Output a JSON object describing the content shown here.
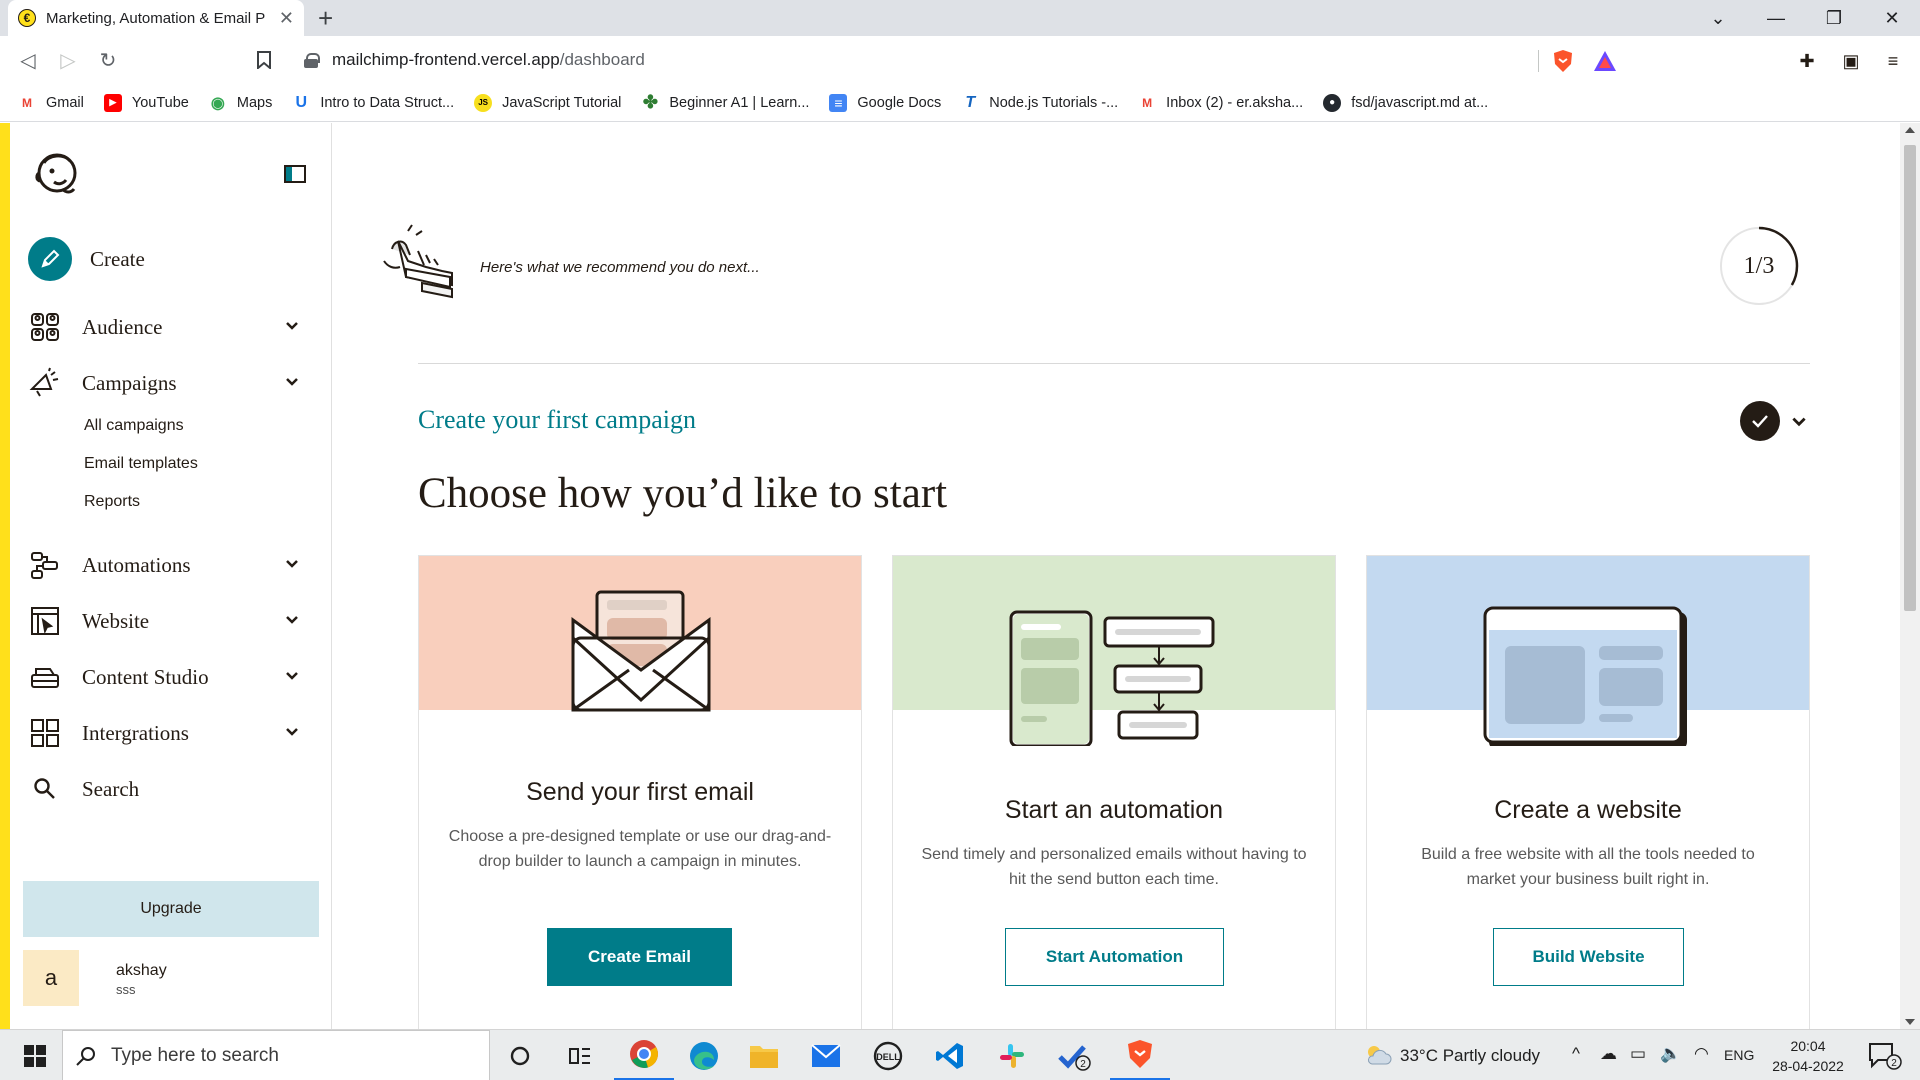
{
  "browser": {
    "tab_title": "Marketing, Automation & Email P",
    "favicon_letter": "€",
    "url_host": "mailchimp-frontend.vercel.app",
    "url_path": "/dashboard",
    "bookmarks": [
      {
        "label": "Gmail",
        "icon": "gmail-icon",
        "color": "#ea4335",
        "glyph": "M"
      },
      {
        "label": "YouTube",
        "icon": "youtube-icon",
        "color": "#ff0000",
        "glyph": "▶"
      },
      {
        "label": "Maps",
        "icon": "maps-icon",
        "color": "#34a853",
        "glyph": "◉"
      },
      {
        "label": "Intro to Data Struct...",
        "icon": "udemy-icon",
        "color": "#1a73e8",
        "glyph": "U"
      },
      {
        "label": "JavaScript Tutorial",
        "icon": "js-icon",
        "color": "#f7df1e",
        "glyph": "JS"
      },
      {
        "label": "Beginner A1 | Learn...",
        "icon": "clover-icon",
        "color": "#2e7d32",
        "glyph": "♣"
      },
      {
        "label": "Google Docs",
        "icon": "docs-icon",
        "color": "#4285f4",
        "glyph": "≡"
      },
      {
        "label": "Node.js Tutorials -...",
        "icon": "tutorial-icon",
        "color": "#1565c0",
        "glyph": "T"
      },
      {
        "label": "Inbox (2) - er.aksha...",
        "icon": "gmail-icon",
        "color": "#ea4335",
        "glyph": "M"
      },
      {
        "label": "fsd/javascript.md at...",
        "icon": "github-icon",
        "color": "#24292f",
        "glyph": "●"
      }
    ]
  },
  "sidebar": {
    "create_label": "Create",
    "items": [
      {
        "label": "Audience",
        "icon": "audience-icon"
      },
      {
        "label": "Campaigns",
        "icon": "megaphone-icon"
      },
      {
        "label": "Automations",
        "icon": "automation-icon"
      },
      {
        "label": "Website",
        "icon": "website-icon"
      },
      {
        "label": "Content Studio",
        "icon": "content-studio-icon"
      },
      {
        "label": "Intergrations",
        "icon": "integrations-icon"
      },
      {
        "label": "Search",
        "icon": "search-icon"
      }
    ],
    "campaign_sub": [
      "All campaigns",
      "Email templates",
      "Reports"
    ],
    "upgrade_label": "Upgrade",
    "user": {
      "initial": "a",
      "name": "akshay",
      "sub": "sss"
    }
  },
  "main": {
    "recommend_text": "Here's what we recommend you do next...",
    "progress": {
      "label": "1/3",
      "fraction": 0.333
    },
    "section_title": "Create your first campaign",
    "heading": "Choose how you’d like to start",
    "cards": [
      {
        "title": "Send your first email",
        "description": "Choose a pre-designed template or use our drag-and-drop builder to launch a campaign in minutes.",
        "button": "Create Email",
        "banner_color": "#f9cfbd",
        "style": "primary"
      },
      {
        "title": "Start an automation",
        "description": "Send timely and personalized emails without having to hit the send button each time.",
        "button": "Start Automation",
        "banner_color": "#d9e9cd",
        "style": "outline"
      },
      {
        "title": "Create a website",
        "description": "Build a free website with all the tools needed to market your business built right in.",
        "button": "Build Website",
        "banner_color": "#c3d9f0",
        "style": "outline"
      }
    ],
    "accent_color": "#007c89"
  },
  "taskbar": {
    "search_placeholder": "Type here to search",
    "weather": "33°C  Partly cloudy",
    "language": "ENG",
    "time": "20:04",
    "date": "28-04-2022",
    "notification_count": "2"
  }
}
